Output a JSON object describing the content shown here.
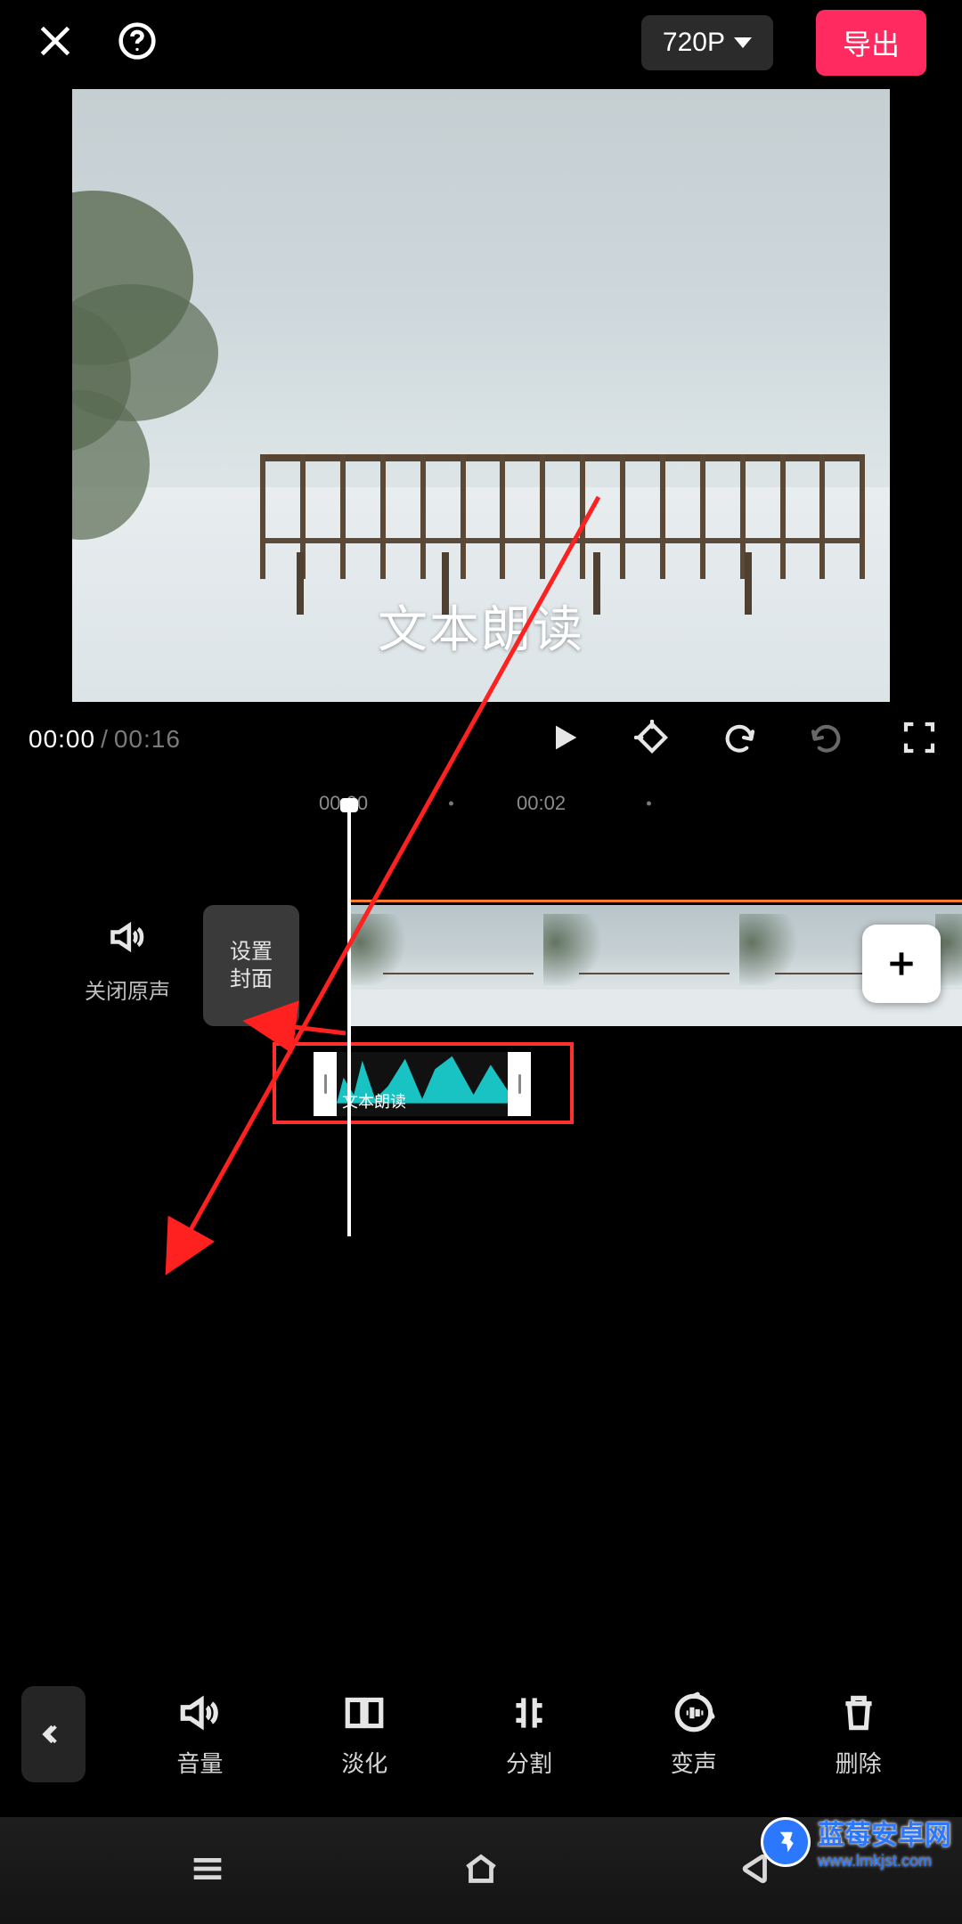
{
  "header": {
    "resolution_label": "720P",
    "export_label": "导出"
  },
  "preview": {
    "overlay_text": "文本朗读"
  },
  "playback": {
    "current_time": "00:00",
    "total_time": "00:16"
  },
  "timeline": {
    "ticks": [
      "00:00",
      "00:02"
    ],
    "mute_label": "关闭原声",
    "cover_button_label": "设置\n封面",
    "audio_clip_label": "文本朗读"
  },
  "toolbar": {
    "items": [
      {
        "key": "volume",
        "label": "音量"
      },
      {
        "key": "fade",
        "label": "淡化"
      },
      {
        "key": "split",
        "label": "分割"
      },
      {
        "key": "voice",
        "label": "变声"
      },
      {
        "key": "delete",
        "label": "删除"
      }
    ]
  },
  "watermark": {
    "title": "蓝莓安卓网",
    "url": "www.lmkjst.com"
  }
}
